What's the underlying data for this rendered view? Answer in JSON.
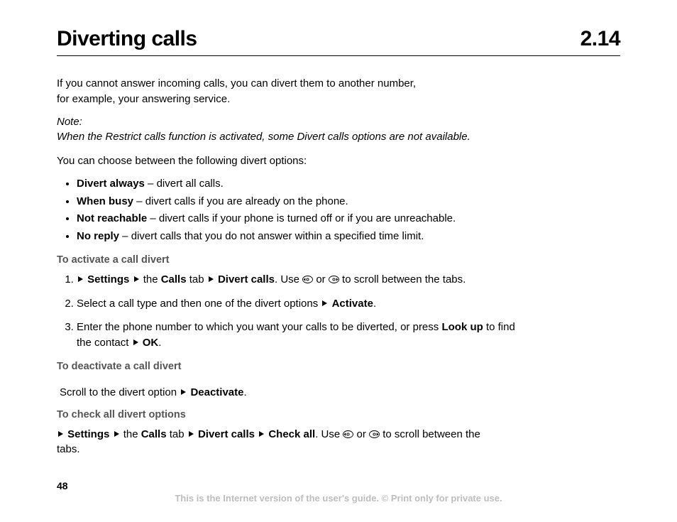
{
  "header": {
    "title": "Diverting calls",
    "section_number": "2.14"
  },
  "intro": {
    "line1": "If you cannot answer incoming calls, you can divert them to another number,",
    "line2": "for example, your answering service."
  },
  "note": {
    "label": "Note:",
    "text": "When the Restrict calls function is activated, some Divert calls options are not available."
  },
  "lead": "You can choose between the following divert options:",
  "options": [
    {
      "term": "Divert always",
      "desc": " – divert all calls."
    },
    {
      "term": "When busy",
      "desc": " – divert calls if you are already on the phone."
    },
    {
      "term": "Not reachable",
      "desc": " – divert calls if your phone is turned off or if you are unreachable."
    },
    {
      "term": "No reply",
      "desc": " – divert calls that you do not answer within a specified time limit."
    }
  ],
  "activate": {
    "heading": "To activate a call divert",
    "step1": {
      "settings": "Settings",
      "the": " the ",
      "calls": "Calls",
      "tab": " tab ",
      "divert": "Divert calls",
      "use": ". Use ",
      "or": " or ",
      "tail": " to scroll between the tabs."
    },
    "step2": {
      "prefix": "Select a call type and then one of the divert options ",
      "activate": "Activate",
      "suffix": "."
    },
    "step3": {
      "prefix": "Enter the phone number to which you want your calls to be diverted, or press ",
      "lookup": "Look up",
      "mid": " to find the contact ",
      "ok": "OK",
      "suffix": "."
    }
  },
  "deactivate": {
    "heading": "To deactivate a call divert",
    "prefix": " Scroll to the divert option ",
    "deactivate": "Deactivate",
    "suffix": "."
  },
  "check": {
    "heading": "To check all divert options",
    "settings": "Settings",
    "the": " the ",
    "calls": "Calls",
    "tab": " tab ",
    "divert": "Divert calls",
    "checkall": "Check all",
    "use": ". Use ",
    "or": " or ",
    "tail": " to scroll between the tabs."
  },
  "footer": {
    "page": "48",
    "note": "This is the Internet version of the user's guide. © Print only for private use."
  }
}
